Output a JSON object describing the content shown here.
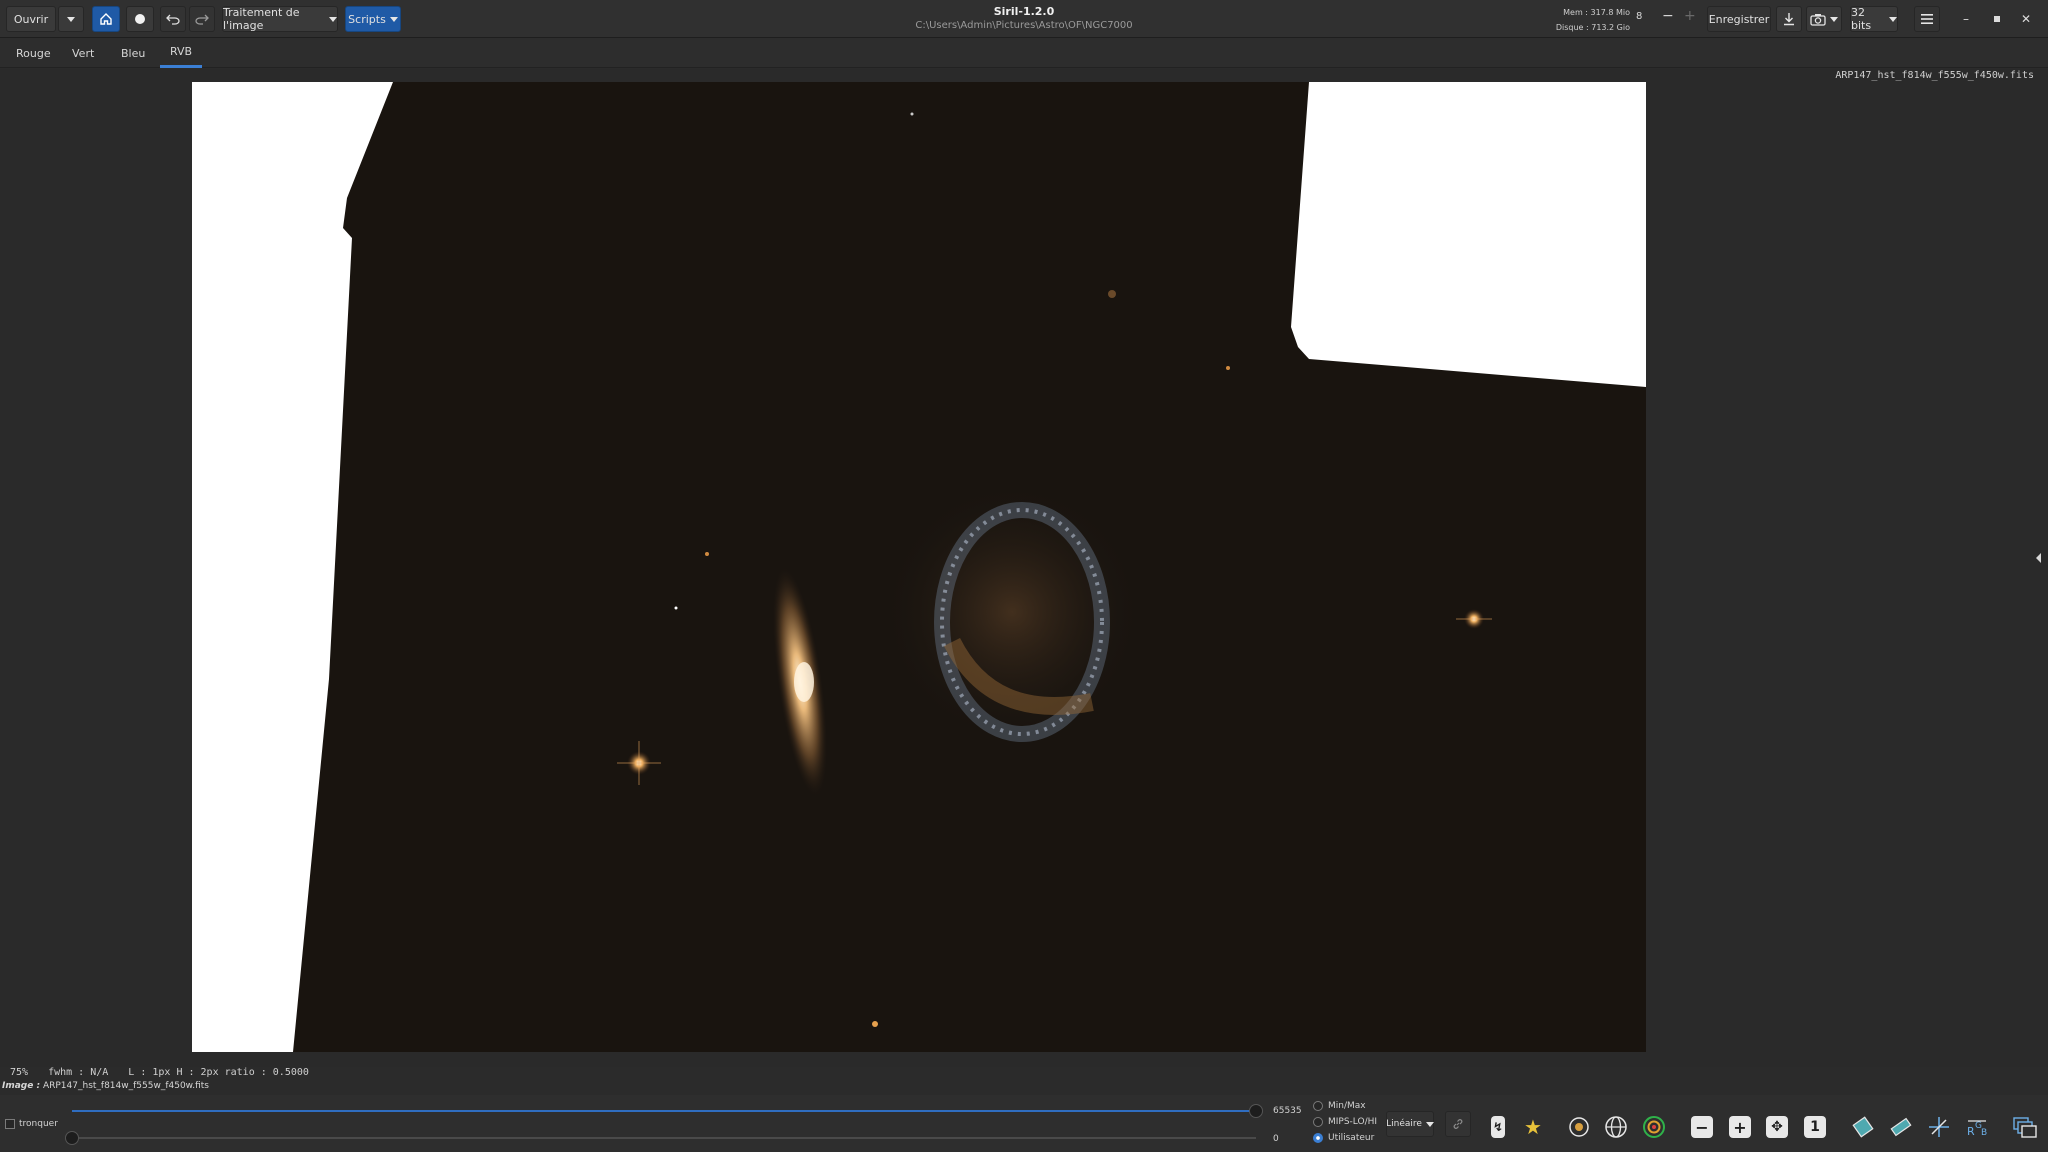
{
  "header": {
    "open_label": "Ouvrir",
    "processing_label": "Traitement de l'image",
    "scripts_label": "Scripts",
    "app_title": "Siril-1.2.0",
    "path": "C:\\Users\\Admin\\Pictures\\Astro\\OF\\NGC7000",
    "mem": "Mem : 317.8 Mio",
    "disk": "Disque : 713.2 Gio",
    "thread_count": "8",
    "save_label": "Enregistrer",
    "bitdepth_label": "32 bits"
  },
  "tabs": [
    {
      "label": "Rouge"
    },
    {
      "label": "Vert"
    },
    {
      "label": "Bleu"
    },
    {
      "label": "RVB"
    }
  ],
  "active_tab": "RVB",
  "viewer": {
    "filename_overlay": "ARP147_hst_f814w_f555w_f450w.fits"
  },
  "info": {
    "zoom": "75%",
    "fwhm": "fwhm : N/A",
    "dims": "L : 1px H : 2px ratio : 0.5000"
  },
  "image_name_label": "Image :",
  "image_name_value": "ARP147_hst_f814w_f555w_f450w.fits",
  "bottom": {
    "clip_label": "tronquer",
    "high_value": "65535",
    "low_value": "0",
    "high_fraction": 1.0,
    "low_fraction": 0.0,
    "modes": [
      {
        "label": "Min/Max",
        "selected": false
      },
      {
        "label": "MIPS-LO/HI",
        "selected": false
      },
      {
        "label": "Utilisateur",
        "selected": true
      }
    ],
    "stretch_label": "Linéaire",
    "icons": [
      "link-icon",
      "flip-icon",
      "star-icon",
      "target-icon",
      "globe-icon",
      "bullseye-icon",
      "zoom-out-icon",
      "zoom-in-icon",
      "zoom-fit-icon",
      "zoom-one-icon",
      "photometry-icon",
      "ruler-icon",
      "crosshair-icon",
      "rgb-icon",
      "layers-icon"
    ]
  },
  "colors": {
    "accent": "#1f5aa6",
    "tab_underline": "#3b7fd4"
  }
}
